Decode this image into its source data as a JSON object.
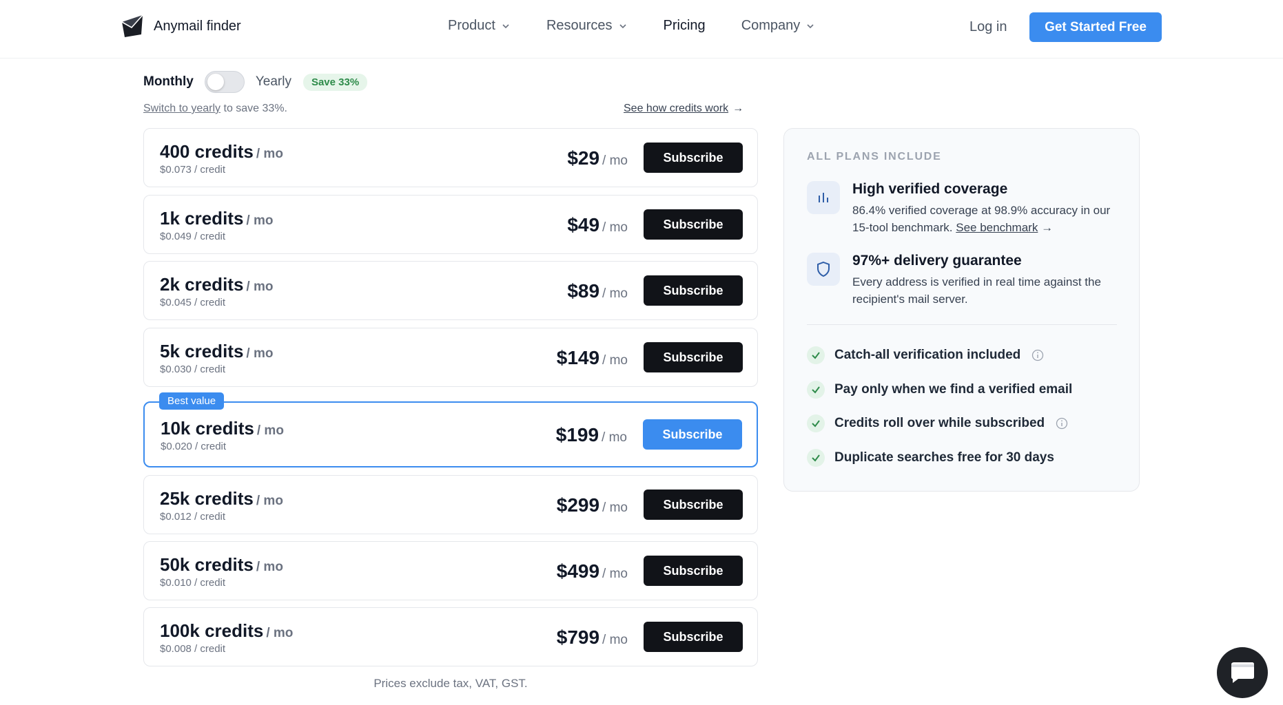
{
  "nav": {
    "logo_text": "Anymail finder",
    "links": [
      {
        "label": "Product"
      },
      {
        "label": "Resources"
      },
      {
        "label": "Pricing"
      },
      {
        "label": "Company"
      }
    ],
    "login": "Log in",
    "cta": "Get Started Free"
  },
  "billing": {
    "monthly": "Monthly",
    "yearly": "Yearly",
    "save_badge": "Save 33%",
    "toggle_on": false,
    "switch_link": "Switch to yearly",
    "switch_rest": " to save 33%.",
    "credits_link": "See how credits work",
    "arrow": "→"
  },
  "plans": [
    {
      "credits": "400 credits",
      "per": "/ mo",
      "unit": "$0.073 / credit",
      "price": "$29",
      "price_per": "/ mo",
      "button": "Subscribe"
    },
    {
      "credits": "1k credits",
      "per": "/ mo",
      "unit": "$0.049 / credit",
      "price": "$49",
      "price_per": "/ mo",
      "button": "Subscribe"
    },
    {
      "credits": "2k credits",
      "per": "/ mo",
      "unit": "$0.045 / credit",
      "price": "$89",
      "price_per": "/ mo",
      "button": "Subscribe"
    },
    {
      "credits": "5k credits",
      "per": "/ mo",
      "unit": "$0.030 / credit",
      "price": "$149",
      "price_per": "/ mo",
      "button": "Subscribe"
    },
    {
      "credits": "10k credits",
      "per": "/ mo",
      "unit": "$0.020 / credit",
      "price": "$199",
      "price_per": "/ mo",
      "button": "Subscribe",
      "badge": "Best value"
    },
    {
      "credits": "25k credits",
      "per": "/ mo",
      "unit": "$0.012 / credit",
      "price": "$299",
      "price_per": "/ mo",
      "button": "Subscribe"
    },
    {
      "credits": "50k credits",
      "per": "/ mo",
      "unit": "$0.010 / credit",
      "price": "$499",
      "price_per": "/ mo",
      "button": "Subscribe"
    },
    {
      "credits": "100k credits",
      "per": "/ mo",
      "unit": "$0.008 / credit",
      "price": "$799",
      "price_per": "/ mo",
      "button": "Subscribe"
    }
  ],
  "footnote": "Prices exclude tax, VAT, GST.",
  "includes": {
    "heading": "ALL PLANS INCLUDE",
    "features": [
      {
        "icon": "bar-chart-icon",
        "title": "High verified coverage",
        "desc": "86.4% verified coverage at 98.9% accuracy in our 15-tool benchmark. ",
        "link": "See benchmark",
        "arrow": "→"
      },
      {
        "icon": "shield-icon",
        "title": "97%+ delivery guarantee",
        "desc": "Every address is verified in real time against the recipient's mail server."
      }
    ],
    "checks": [
      {
        "label": "Catch-all verification included",
        "info": true
      },
      {
        "label": "Pay only when we find a verified email",
        "info": false
      },
      {
        "label": "Credits roll over while subscribed",
        "info": true
      },
      {
        "label": "Duplicate searches free for 30 days",
        "info": false
      }
    ]
  },
  "colors": {
    "accent": "#3b8cef",
    "dark_button": "#111318",
    "success": "#2e8b4a"
  }
}
